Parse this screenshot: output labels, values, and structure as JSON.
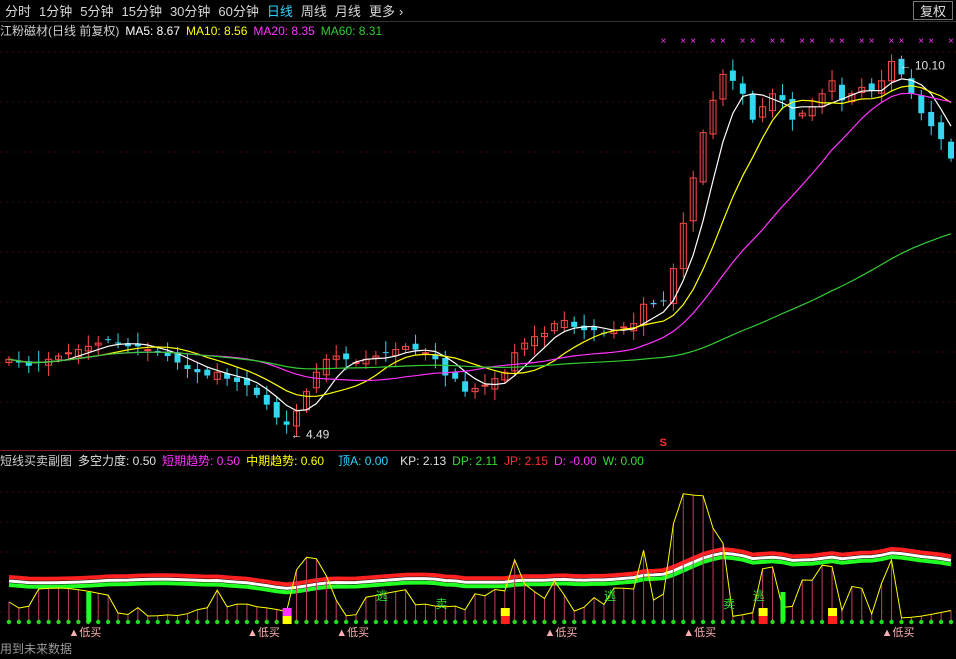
{
  "toolbar": {
    "tabs": [
      {
        "label": "分时",
        "active": false
      },
      {
        "label": "1分钟",
        "active": false
      },
      {
        "label": "5分钟",
        "active": false
      },
      {
        "label": "15分钟",
        "active": false
      },
      {
        "label": "30分钟",
        "active": false
      },
      {
        "label": "60分钟",
        "active": false
      },
      {
        "label": "日线",
        "active": true
      },
      {
        "label": "周线",
        "active": false
      },
      {
        "label": "月线",
        "active": false
      }
    ],
    "more_label": "更多",
    "more_icon": "chevron-right-icon",
    "fuquan_label": "复权"
  },
  "main_legend": {
    "title": "江粉磁材(日线 前复权)",
    "ma5": "MA5: 8.67",
    "ma10": "MA10: 8.56",
    "ma20": "MA20: 8.35",
    "ma60": "MA60: 8.31"
  },
  "sub_legend": {
    "title": "短线买卖副图",
    "duokong": "多空力度: 0.50",
    "short_trend": "短期趋势: 0.50",
    "mid_trend": "中期趋势: 0.60",
    "top_a": "顶A: 0.00",
    "kp": "KP: 2.13",
    "dp": "DP: 2.11",
    "jp": "JP: 2.15",
    "d": "D: -0.00",
    "w": "W: 0.00"
  },
  "annotations": {
    "high_label": "10.10",
    "low_label": "4.49",
    "s_marker": "S",
    "x_mark": "×",
    "low_buy": "低买",
    "escape": "逃",
    "sell": "卖"
  },
  "footer": "用到未来数据",
  "colors": {
    "up": "#ff4a4a",
    "down": "#35d6f0",
    "ma5": "#ffffff",
    "ma10": "#ffff00",
    "ma20": "#ff33ff",
    "ma60": "#33cc33",
    "accent": "#2fd4ff",
    "red": "#ff2020",
    "green": "#22ff22"
  },
  "chart_data": {
    "type": "candlestick",
    "close_approx": [
      5.5,
      5.45,
      5.4,
      5.45,
      5.5,
      5.55,
      5.6,
      5.65,
      5.7,
      5.75,
      5.8,
      5.75,
      5.7,
      5.7,
      5.65,
      5.6,
      5.55,
      5.45,
      5.35,
      5.3,
      5.25,
      5.3,
      5.2,
      5.15,
      5.1,
      4.95,
      4.8,
      4.6,
      4.49,
      4.7,
      5.0,
      5.3,
      5.5,
      5.55,
      5.5,
      5.45,
      5.5,
      5.55,
      5.6,
      5.65,
      5.7,
      5.65,
      5.6,
      5.5,
      5.25,
      5.2,
      5.0,
      5.05,
      5.1,
      5.2,
      5.3,
      5.6,
      5.75,
      5.85,
      5.9,
      6.05,
      6.1,
      6.0,
      5.95,
      5.95,
      5.9,
      5.95,
      6.0,
      6.05,
      6.35,
      6.35,
      6.4,
      6.9,
      7.6,
      8.3,
      9.0,
      9.5,
      9.9,
      9.8,
      9.6,
      9.2,
      9.4,
      9.6,
      9.5,
      9.2,
      9.3,
      9.4,
      9.6,
      9.8,
      9.5,
      9.6,
      9.7,
      9.65,
      9.8,
      10.1,
      9.9,
      9.6,
      9.3,
      9.1,
      8.9,
      8.6
    ],
    "high_marked": 10.1,
    "low_marked": 4.49,
    "ma_series": [
      "MA5",
      "MA10",
      "MA20",
      "MA60"
    ]
  }
}
